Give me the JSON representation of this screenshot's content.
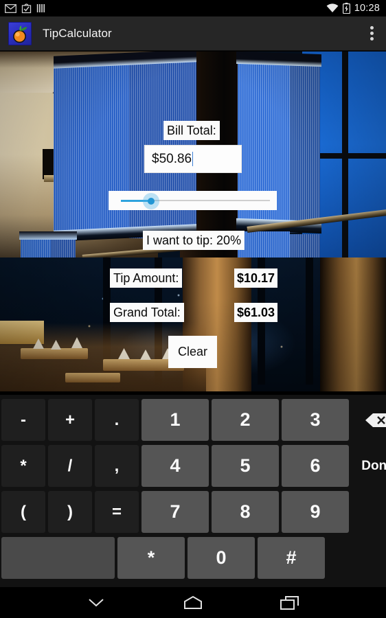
{
  "status_bar": {
    "icons": [
      "gmail-icon",
      "checkbox-app-icon",
      "bars-icon"
    ],
    "right_icons": [
      "wifi-icon",
      "battery-charging-icon"
    ],
    "clock": "10:28"
  },
  "action_bar": {
    "app_icon": "orange-fruit-app-icon",
    "title": "TipCalculator",
    "overflow": "overflow-menu-icon"
  },
  "app": {
    "bill_total_label": "Bill Total:",
    "bill_total_value": "$50.86",
    "tip_percent_label": "I want to tip: 20%",
    "tip_amount_label": "Tip Amount:",
    "tip_amount_value": "$10.17",
    "grand_total_label": "Grand Total:",
    "grand_total_value": "$61.03",
    "clear_label": "Clear",
    "slider": {
      "value": 20,
      "min": 0,
      "max": 100,
      "fill_color": "#2fa3dd",
      "thumb_color": "#2196d4",
      "track_color": "#cfcfcf"
    }
  },
  "keyboard": {
    "rows": [
      [
        {
          "label": "-",
          "type": "fn",
          "name": "key-minus"
        },
        {
          "label": "+",
          "type": "fn",
          "name": "key-plus"
        },
        {
          "label": ".",
          "type": "fn",
          "name": "key-period"
        },
        {
          "label": "1",
          "type": "num",
          "name": "key-1"
        },
        {
          "label": "2",
          "type": "num",
          "name": "key-2"
        },
        {
          "label": "3",
          "type": "num",
          "name": "key-3"
        },
        {
          "label": "",
          "type": "backspace",
          "name": "key-backspace"
        }
      ],
      [
        {
          "label": "*",
          "type": "fn",
          "name": "key-asterisk-fn"
        },
        {
          "label": "/",
          "type": "fn",
          "name": "key-slash"
        },
        {
          "label": ",",
          "type": "fn",
          "name": "key-comma"
        },
        {
          "label": "4",
          "type": "num",
          "name": "key-4"
        },
        {
          "label": "5",
          "type": "num",
          "name": "key-5"
        },
        {
          "label": "6",
          "type": "num",
          "name": "key-6"
        },
        {
          "label": "Done",
          "type": "side",
          "name": "key-done"
        }
      ],
      [
        {
          "label": "(",
          "type": "fn",
          "name": "key-paren-open"
        },
        {
          "label": ")",
          "type": "fn",
          "name": "key-paren-close"
        },
        {
          "label": "=",
          "type": "fn",
          "name": "key-equals"
        },
        {
          "label": "7",
          "type": "num",
          "name": "key-7"
        },
        {
          "label": "8",
          "type": "num",
          "name": "key-8"
        },
        {
          "label": "9",
          "type": "num",
          "name": "key-9"
        },
        {
          "label": "",
          "type": "blank-side",
          "name": "key-blank-1"
        }
      ],
      [
        {
          "label": "",
          "type": "space",
          "name": "key-space"
        },
        {
          "label": "*",
          "type": "num",
          "name": "key-asterisk"
        },
        {
          "label": "0",
          "type": "num",
          "name": "key-0"
        },
        {
          "label": "#",
          "type": "num",
          "name": "key-hash"
        },
        {
          "label": "",
          "type": "blank-side",
          "name": "key-blank-2"
        }
      ]
    ]
  },
  "nav_bar": {
    "buttons": [
      "hide-keyboard-chevron-icon",
      "home-icon",
      "recent-apps-icon"
    ]
  }
}
